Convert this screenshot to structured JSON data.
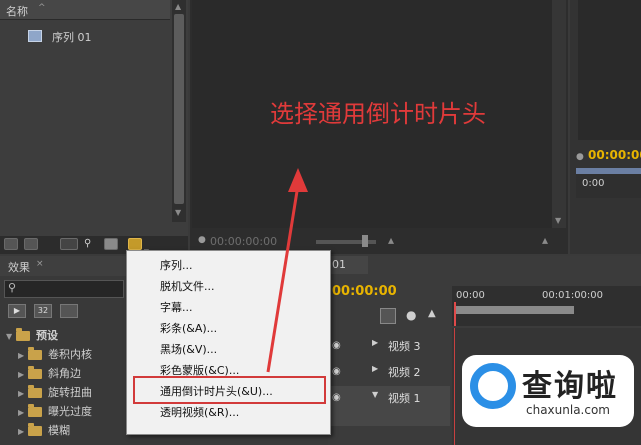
{
  "project_panel": {
    "column_name": "名称",
    "item_label": "序列 01"
  },
  "source_monitor": {
    "timecode": "00:00:00:00"
  },
  "program_monitor": {
    "timecode": "00:00:00",
    "timecode_small": "0:00"
  },
  "effects_panel": {
    "tab_label": "效果",
    "btn_a": "32",
    "tree": [
      {
        "label": "预设",
        "expanded": true
      },
      {
        "label": "卷积内核"
      },
      {
        "label": "斜角边"
      },
      {
        "label": "旋转扭曲"
      },
      {
        "label": "曝光过度"
      },
      {
        "label": "模糊"
      }
    ]
  },
  "timeline": {
    "tab_label": "01",
    "timecode": "00:00:00",
    "ruler_start": "00:00",
    "ruler_mid": "00:01:00:00",
    "tracks": [
      "视频 3",
      "视频 2",
      "视频 1"
    ]
  },
  "context_menu": {
    "items": [
      "序列...",
      "脱机文件...",
      "字幕...",
      "彩条(&A)...",
      "黑场(&V)...",
      "彩色蒙版(&C)...",
      "通用倒计时片头(&U)...",
      "透明视频(&R)..."
    ],
    "highlighted_index": 6
  },
  "annotation": {
    "text": "选择通用倒计时片头",
    "color": "#e03a3a"
  },
  "watermark": {
    "brand": "查询啦",
    "url": "chaxunla.com"
  }
}
